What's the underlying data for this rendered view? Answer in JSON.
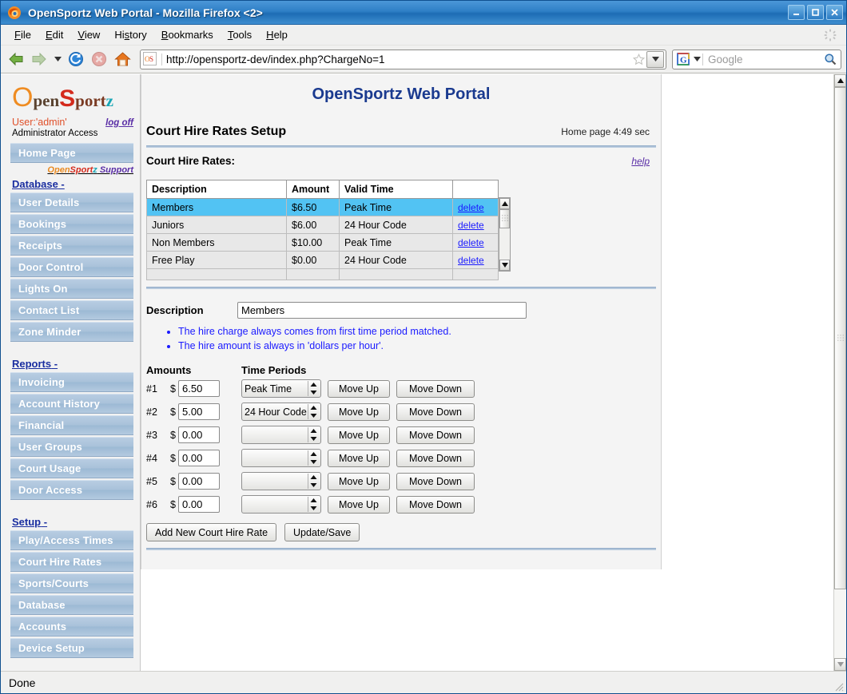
{
  "window": {
    "title": "OpenSportz Web Portal - Mozilla Firefox <2>",
    "minimize_label": "minimize",
    "maximize_label": "maximize",
    "close_label": "close"
  },
  "menubar": {
    "items": [
      "File",
      "Edit",
      "View",
      "History",
      "Bookmarks",
      "Tools",
      "Help"
    ]
  },
  "toolbar": {
    "back_label": "Back",
    "forward_label": "Forward",
    "history_dropdown_label": "Recent pages",
    "reload_label": "Reload",
    "stop_label": "Stop",
    "home_label": "Home",
    "url": "http://opensportz-dev/index.php?ChargeNo=1",
    "bookmark_label": "Bookmark this page",
    "go_label": "Go",
    "search_placeholder": "Google",
    "search_engine": "Google",
    "search_value": ""
  },
  "statusbar": {
    "text": "Done"
  },
  "sidebar": {
    "logo": {
      "part_o": "O",
      "part_pen": "pen",
      "part_s": "S",
      "part_port": "port",
      "part_z": "z"
    },
    "user": "User:'admin'",
    "logoff": "log off",
    "access": "Administrator Access",
    "home_page": "Home Page",
    "support": {
      "open": "Open",
      "sport": "Sport",
      "z": "z",
      "support": " Support"
    },
    "groups": [
      {
        "title": "Database",
        "dash": " -",
        "items": [
          "User Details",
          "Bookings",
          "Receipts",
          "Door Control",
          "Lights On",
          "Contact List",
          "Zone Minder"
        ]
      },
      {
        "title": "Reports",
        "dash": " -",
        "items": [
          "Invoicing",
          "Account History",
          "Financial",
          "User Groups",
          "Court Usage",
          "Door Access"
        ]
      },
      {
        "title": "Setup",
        "dash": " -",
        "items": [
          "Play/Access Times",
          "Court Hire Rates",
          "Sports/Courts",
          "Database",
          "Accounts",
          "Device Setup"
        ]
      }
    ]
  },
  "main": {
    "portal_title": "OpenSportz Web Portal",
    "section_title": "Court Hire Rates Setup",
    "home_timer": "Home page 4:49 sec",
    "sub_title": "Court Hire Rates:",
    "help_label": "help",
    "table": {
      "headers": [
        "Description",
        "Amount",
        "Valid Time",
        ""
      ],
      "rows": [
        {
          "description": "Members",
          "amount": "$6.50",
          "valid_time": "Peak Time",
          "action": "delete",
          "selected": true
        },
        {
          "description": "Juniors",
          "amount": "$6.00",
          "valid_time": "24 Hour Code",
          "action": "delete",
          "selected": false
        },
        {
          "description": "Non Members",
          "amount": "$10.00",
          "valid_time": "Peak Time",
          "action": "delete",
          "selected": false
        },
        {
          "description": "Free Play",
          "amount": "$0.00",
          "valid_time": "24 Hour Code",
          "action": "delete",
          "selected": false
        }
      ]
    },
    "form": {
      "description_label": "Description",
      "description_value": "Members",
      "notes": [
        "The hire charge always comes from first time period matched.",
        "The hire amount is always in 'dollars per hour'."
      ],
      "amounts_header": "Amounts",
      "time_periods_header": "Time Periods",
      "move_up_label": "Move Up",
      "move_down_label": "Move Down",
      "rows": [
        {
          "num": "#1",
          "dollar": "$",
          "amount": "6.50",
          "period": "Peak Time"
        },
        {
          "num": "#2",
          "dollar": "$",
          "amount": "5.00",
          "period": "24 Hour Code"
        },
        {
          "num": "#3",
          "dollar": "$",
          "amount": "0.00",
          "period": ""
        },
        {
          "num": "#4",
          "dollar": "$",
          "amount": "0.00",
          "period": ""
        },
        {
          "num": "#5",
          "dollar": "$",
          "amount": "0.00",
          "period": ""
        },
        {
          "num": "#6",
          "dollar": "$",
          "amount": "0.00",
          "period": ""
        }
      ],
      "add_button": "Add New Court Hire Rate",
      "save_button": "Update/Save"
    }
  },
  "colors": {
    "accent_blue": "#1a3a8f",
    "selected_row": "#52c3f3",
    "link": "#1a1aff",
    "menu_item_bg": "#a9c2da",
    "titlebar": "#2f7fc6"
  }
}
